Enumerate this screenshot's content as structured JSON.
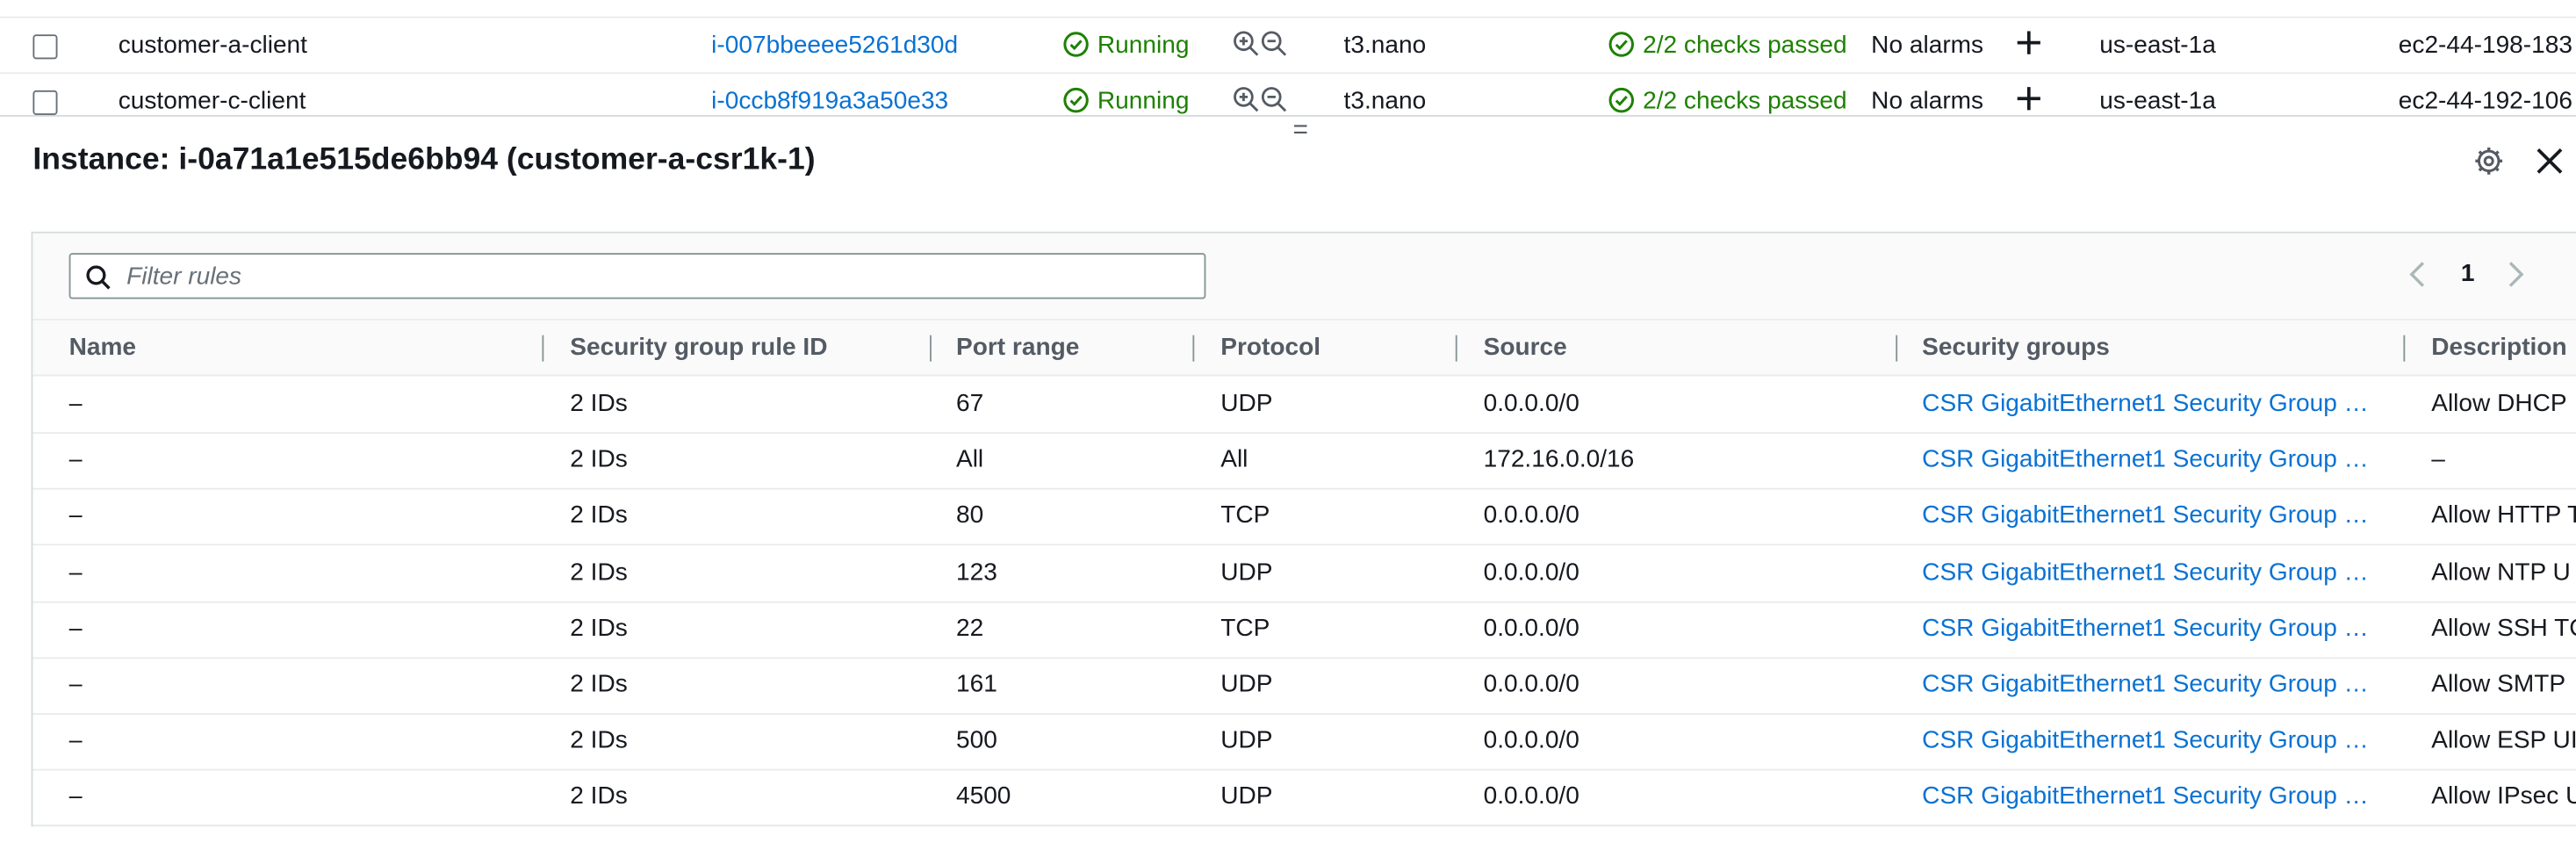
{
  "instances": [
    {
      "name": "customer-a-client",
      "instance_id": "i-007bbeeee5261d30d",
      "state": "Running",
      "type": "t3.nano",
      "status_check": "2/2 checks passed",
      "alarms": "No alarms",
      "az": "us-east-1a",
      "dns": "ec2-44-198-183"
    },
    {
      "name": "customer-c-client",
      "instance_id": "i-0ccb8f919a3a50e33",
      "state": "Running",
      "type": "t3.nano",
      "status_check": "2/2 checks passed",
      "alarms": "No alarms",
      "az": "us-east-1a",
      "dns": "ec2-44-192-106"
    }
  ],
  "resize_handle": "=",
  "detail": {
    "title": "Instance: i-0a71a1e515de6bb94 (customer-a-csr1k-1)"
  },
  "filter": {
    "placeholder": "Filter rules"
  },
  "pagination": {
    "page": "1"
  },
  "columns": [
    "Name",
    "Security group rule ID",
    "Port range",
    "Protocol",
    "Source",
    "Security groups",
    "Description"
  ],
  "rules": [
    {
      "name": "–",
      "rule_id": "2 IDs",
      "port": "67",
      "protocol": "UDP",
      "source": "0.0.0.0/0",
      "sg": "CSR GigabitEthernet1 Security Group …",
      "desc": "Allow DHCP"
    },
    {
      "name": "–",
      "rule_id": "2 IDs",
      "port": "All",
      "protocol": "All",
      "source": "172.16.0.0/16",
      "sg": "CSR GigabitEthernet1 Security Group …",
      "desc": "–"
    },
    {
      "name": "–",
      "rule_id": "2 IDs",
      "port": "80",
      "protocol": "TCP",
      "source": "0.0.0.0/0",
      "sg": "CSR GigabitEthernet1 Security Group …",
      "desc": "Allow HTTP T"
    },
    {
      "name": "–",
      "rule_id": "2 IDs",
      "port": "123",
      "protocol": "UDP",
      "source": "0.0.0.0/0",
      "sg": "CSR GigabitEthernet1 Security Group …",
      "desc": "Allow NTP U"
    },
    {
      "name": "–",
      "rule_id": "2 IDs",
      "port": "22",
      "protocol": "TCP",
      "source": "0.0.0.0/0",
      "sg": "CSR GigabitEthernet1 Security Group …",
      "desc": "Allow SSH TC"
    },
    {
      "name": "–",
      "rule_id": "2 IDs",
      "port": "161",
      "protocol": "UDP",
      "source": "0.0.0.0/0",
      "sg": "CSR GigabitEthernet1 Security Group …",
      "desc": "Allow SMTP"
    },
    {
      "name": "–",
      "rule_id": "2 IDs",
      "port": "500",
      "protocol": "UDP",
      "source": "0.0.0.0/0",
      "sg": "CSR GigabitEthernet1 Security Group …",
      "desc": "Allow ESP UI"
    },
    {
      "name": "–",
      "rule_id": "2 IDs",
      "port": "4500",
      "protocol": "UDP",
      "source": "0.0.0.0/0",
      "sg": "CSR GigabitEthernet1 Security Group …",
      "desc": "Allow IPsec U"
    }
  ],
  "colors": {
    "link": "#0972d3",
    "success": "#1d8102",
    "header_text": "#545b64"
  },
  "icons": [
    "checkbox-icon",
    "check-circle-icon",
    "zoom-in-icon",
    "zoom-out-icon",
    "plus-icon",
    "gear-icon",
    "close-icon",
    "search-icon",
    "chevron-left-icon",
    "chevron-right-icon"
  ]
}
